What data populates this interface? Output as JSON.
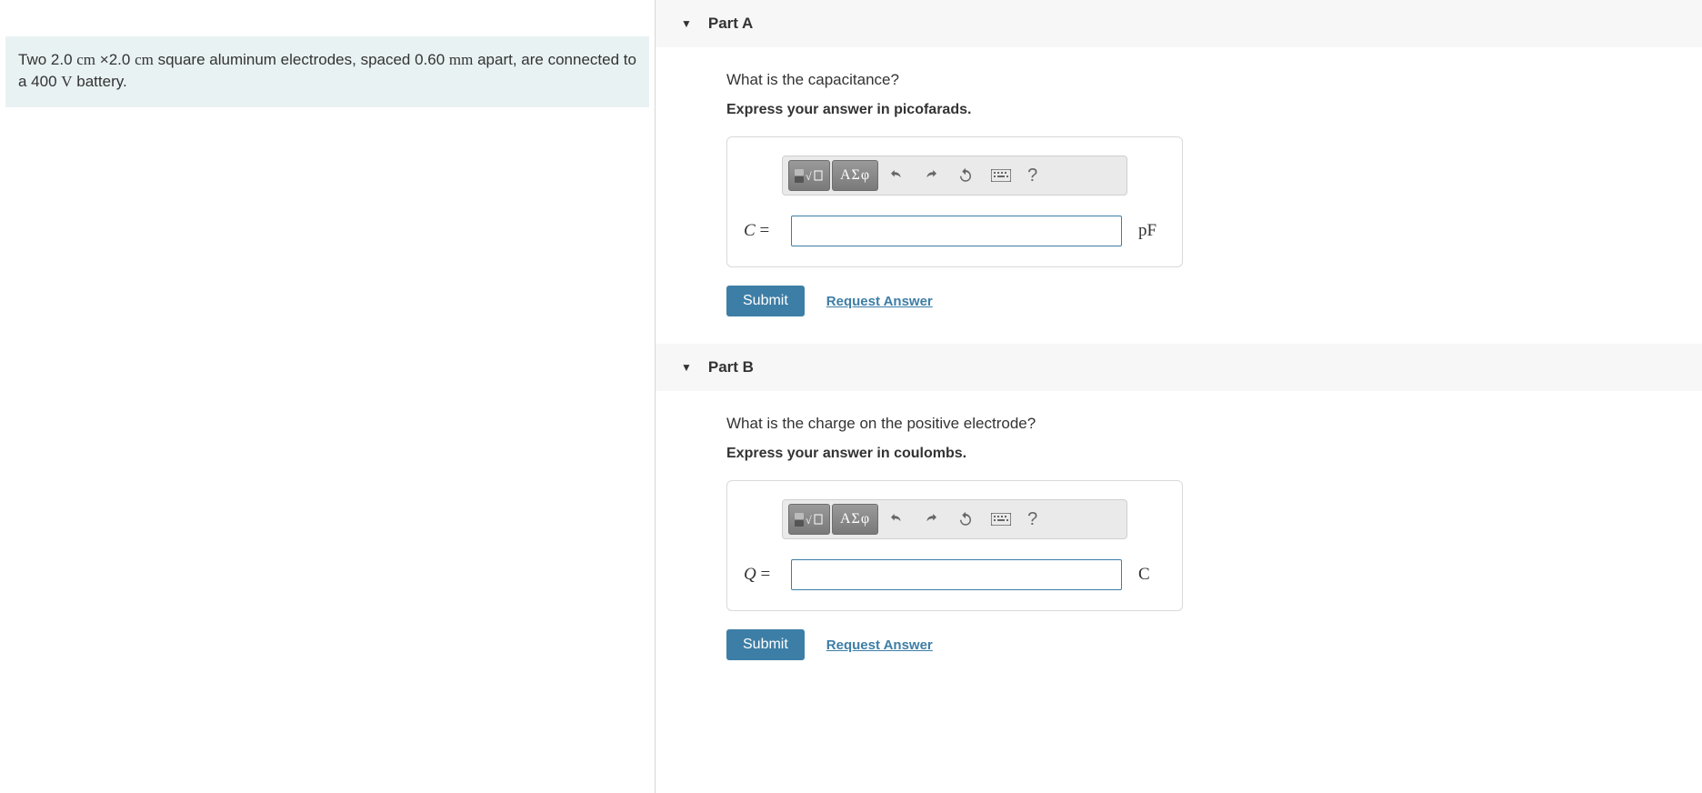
{
  "problem": {
    "text_pre": "Two 2.0 ",
    "unit_cm1": "cm",
    "times": " ×",
    "dim2": "2.0 ",
    "unit_cm2": "cm",
    "text_mid": " square aluminum electrodes, spaced 0.60 ",
    "unit_mm": "mm",
    "text_mid2": " apart, are connected to a 400 ",
    "unit_V": "V",
    "text_end": " battery."
  },
  "toolbar": {
    "greek": "ΑΣφ",
    "help": "?"
  },
  "partA": {
    "title": "Part A",
    "question": "What is the capacitance?",
    "instruction": "Express your answer in picofarads.",
    "variable": "C",
    "equals": "=",
    "unit": "pF",
    "submit": "Submit",
    "request": "Request Answer"
  },
  "partB": {
    "title": "Part B",
    "question": "What is the charge on the positive electrode?",
    "instruction": "Express your answer in coulombs.",
    "variable": "Q",
    "equals": "=",
    "unit": "C",
    "submit": "Submit",
    "request": "Request Answer"
  }
}
